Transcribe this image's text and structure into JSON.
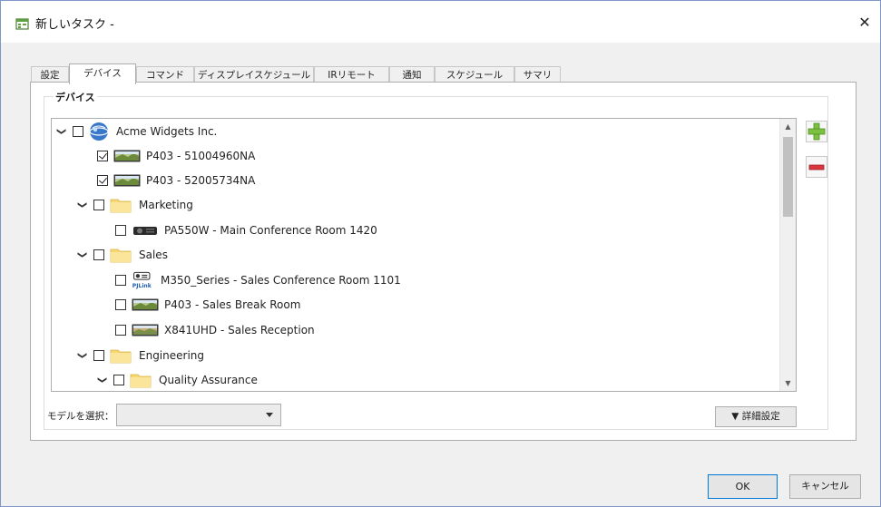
{
  "window": {
    "title": "新しいタスク -",
    "close_glyph": "✕"
  },
  "tabs": [
    {
      "label": "設定",
      "active": false
    },
    {
      "label": "デバイス",
      "active": true
    },
    {
      "label": "コマンド",
      "active": false
    },
    {
      "label": "ディスプレイスケジュール",
      "active": false
    },
    {
      "label": "IRリモート",
      "active": false
    },
    {
      "label": "通知",
      "active": false
    },
    {
      "label": "スケジュール",
      "active": false
    },
    {
      "label": "サマリ",
      "active": false
    }
  ],
  "device_group": {
    "label": "デバイス",
    "tree": [
      {
        "label": "Acme Widgets Inc.",
        "type": "organization",
        "icon": "globe-icon",
        "expanded": true,
        "checked": false
      },
      {
        "label": "P403 - 51004960NA",
        "type": "device",
        "icon": "display-icon",
        "checked": true
      },
      {
        "label": "P403 - 52005734NA",
        "type": "device",
        "icon": "display-icon",
        "checked": true
      },
      {
        "label": "Marketing",
        "type": "folder",
        "icon": "folder-icon",
        "expanded": true,
        "checked": false
      },
      {
        "label": "PA550W - Main Conference Room 1420",
        "type": "device",
        "icon": "projector-icon",
        "checked": false
      },
      {
        "label": "Sales",
        "type": "folder",
        "icon": "folder-icon",
        "expanded": true,
        "checked": false
      },
      {
        "label": "M350_Series - Sales Conference Room 1101",
        "type": "device",
        "icon": "pjlink-projector-icon",
        "badge": "PJLink",
        "checked": false
      },
      {
        "label": "P403 - Sales Break Room",
        "type": "device",
        "icon": "display-icon",
        "checked": false
      },
      {
        "label": "X841UHD - Sales Reception",
        "type": "device",
        "icon": "display-icon",
        "checked": false
      },
      {
        "label": "Engineering",
        "type": "folder",
        "icon": "folder-icon",
        "expanded": true,
        "checked": false
      },
      {
        "label": "Quality Assurance",
        "type": "folder",
        "icon": "folder-icon",
        "expanded": true,
        "checked": false
      }
    ],
    "model_select": {
      "label": "モデルを選択：",
      "value": ""
    },
    "advanced_button": "▼ 詳細設定"
  },
  "buttons": {
    "ok": "OK",
    "cancel": "キャンセル"
  },
  "colors": {
    "add": "#7dc142",
    "remove": "#d9363e",
    "folder": "#f7d774",
    "focus_border": "#0078d7"
  }
}
